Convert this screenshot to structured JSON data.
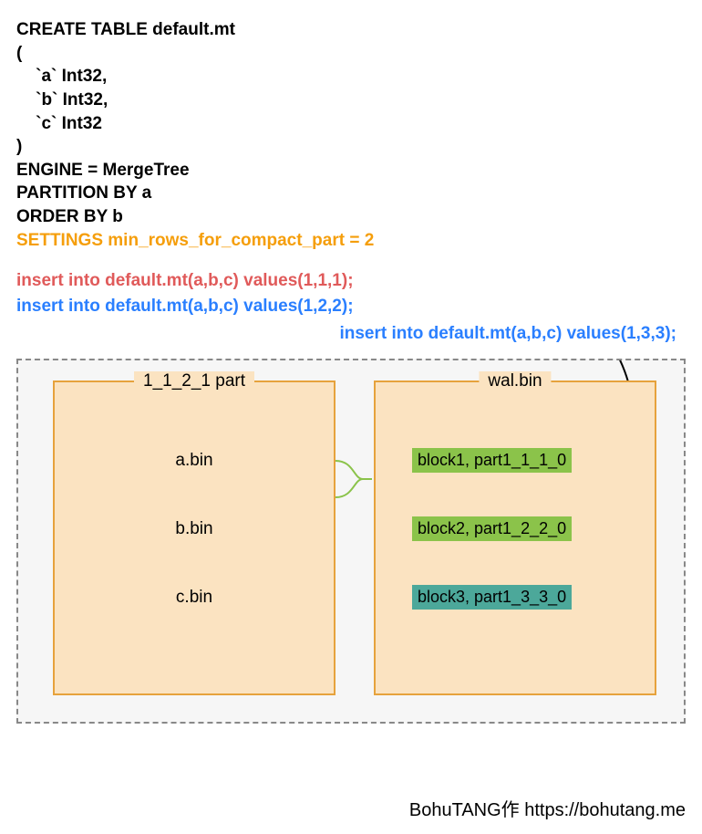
{
  "sql": {
    "l1": "CREATE TABLE default.mt",
    "l2": "(",
    "l3": "    `a` Int32,",
    "l4": "    `b` Int32,",
    "l5": "    `c` Int32",
    "l6": ")",
    "l7": "ENGINE = MergeTree",
    "l8": "PARTITION BY a",
    "l9": "ORDER BY b",
    "l10": "SETTINGS min_rows_for_compact_part = 2"
  },
  "inserts": {
    "i1": "insert into default.mt(a,b,c) values(1,1,1);",
    "i2": "insert into default.mt(a,b,c) values(1,2,2);",
    "i3": "insert into default.mt(a,b,c) values(1,3,3);"
  },
  "part": {
    "title": "1_1_2_1 part",
    "files": {
      "a": "a.bin",
      "b": "b.bin",
      "c": "c.bin"
    }
  },
  "wal": {
    "title": "wal.bin",
    "blocks": {
      "b1": "block1, part1_1_1_0",
      "b2": "block2, part1_2_2_0",
      "b3": "block3, part1_3_3_0"
    }
  },
  "credit": "BohuTANG作 https://bohutang.me"
}
